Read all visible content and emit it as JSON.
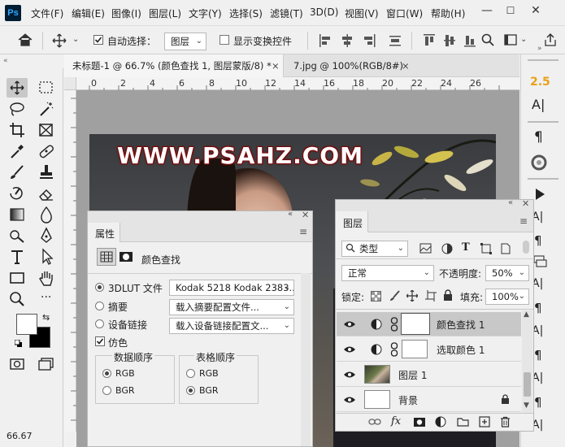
{
  "app": {
    "logo": "Ps"
  },
  "menu": [
    "文件(F)",
    "编辑(E)",
    "图像(I)",
    "图层(L)",
    "文字(Y)",
    "选择(S)",
    "滤镜(T)",
    "3D(D)",
    "视图(V)",
    "窗口(W)",
    "帮助(H)"
  ],
  "window_controls": {
    "minimize": "—",
    "maximize": "☐",
    "close": "✕"
  },
  "options": {
    "auto_select_label": "自动选择：",
    "auto_select_target": "图层",
    "show_transform_label": "显示变换控件",
    "checkbox_auto_select_checked": true,
    "checkbox_transform_checked": false
  },
  "tabs": [
    {
      "label": "未标题-1 @ 66.7% (颜色查找 1, 图层蒙版/8) *",
      "close": "×",
      "active": true
    },
    {
      "label": "7.jpg @ 100%(RGB/8#)",
      "close": "×",
      "active": false
    }
  ],
  "ruler": {
    "h_ticks": [
      "0",
      "2",
      "4",
      "6",
      "8",
      "10",
      "12",
      "14",
      "16",
      "18",
      "20",
      "22",
      "24",
      "26"
    ]
  },
  "canvas": {
    "watermark": "WWW.PSAHZ.COM"
  },
  "status": {
    "zoom": "66.67"
  },
  "right_strip": {
    "version_badge": "2.5"
  },
  "properties": {
    "tab": "属性",
    "adjustment_name": "颜色查找",
    "rows": [
      {
        "label": "3DLUT 文件",
        "value": "Kodak 5218 Kodak 2383...",
        "selected": true
      },
      {
        "label": "摘要",
        "value": "载入摘要配置文件...",
        "selected": false
      },
      {
        "label": "设备链接",
        "value": "载入设备链接配置文...",
        "selected": false
      }
    ],
    "dither_label": "仿色",
    "dither_checked": true,
    "data_order_title": "数据顺序",
    "data_order": [
      {
        "label": "RGB",
        "selected": true
      },
      {
        "label": "BGR",
        "selected": false
      }
    ],
    "table_order_title": "表格顺序",
    "table_order": [
      {
        "label": "RGB",
        "selected": false
      },
      {
        "label": "BGR",
        "selected": true
      }
    ]
  },
  "layers": {
    "tab": "图层",
    "filter_kind": "类型",
    "blend_mode": "正常",
    "opacity_label": "不透明度:",
    "opacity_value": "50%",
    "lock_label": "锁定:",
    "fill_label": "填充:",
    "fill_value": "100%",
    "items": [
      {
        "name": "颜色查找",
        "count": "1",
        "selected": true
      },
      {
        "name": "选取颜色",
        "count": "1",
        "selected": false
      },
      {
        "name": "图层",
        "count": "1",
        "selected": false
      },
      {
        "name": "背景",
        "count": "",
        "selected": false
      }
    ],
    "footer_fx": "fx"
  },
  "colors": {
    "accent_orange": "#e8a117",
    "selection_gray": "#c8c8c8",
    "ps_blue": "#31a8ff"
  }
}
